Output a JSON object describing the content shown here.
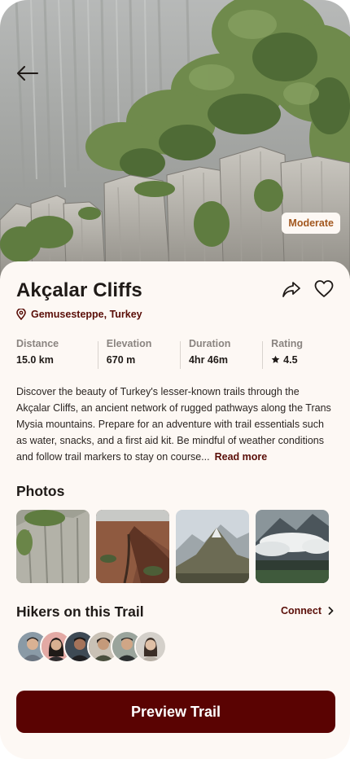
{
  "hero": {
    "back_icon": "arrow-left-icon",
    "difficulty": "Moderate"
  },
  "trail": {
    "name": "Akçalar Cliffs",
    "location": "Gemusesteppe, Turkey",
    "location_icon": "map-pin-icon",
    "share_icon": "share-arrow-icon",
    "favorite_icon": "heart-icon"
  },
  "stats": [
    {
      "label": "Distance",
      "value": "15.0 km"
    },
    {
      "label": "Elevation",
      "value": "670 m"
    },
    {
      "label": "Duration",
      "value": "4hr 46m"
    },
    {
      "label": "Rating",
      "value": "4.5",
      "icon": "star-icon"
    }
  ],
  "description": {
    "text": "Discover the beauty of Turkey's lesser-known trails through the Akçalar Cliffs, an ancient network of rugged pathways along the Trans Mysia mountains. Prepare for an adventure with trail essentials such as water, snacks, and a first aid kit. Be mindful of weather conditions and follow trail markers to stay on course...",
    "read_more": "Read more"
  },
  "photos": {
    "title": "Photos",
    "items": [
      "cliff-photo",
      "canyon-photo",
      "mountain-ridge-photo",
      "cloudy-peaks-photo"
    ]
  },
  "hikers": {
    "title": "Hikers on this Trail",
    "connect_label": "Connect",
    "connect_icon": "chevron-right-icon",
    "count": 6
  },
  "cta": {
    "label": "Preview Trail"
  },
  "colors": {
    "background": "#fdf8f4",
    "accent": "#5a0302",
    "accent_text": "#5a0e08",
    "badge_text": "#a2571e",
    "muted": "#8a8480"
  }
}
